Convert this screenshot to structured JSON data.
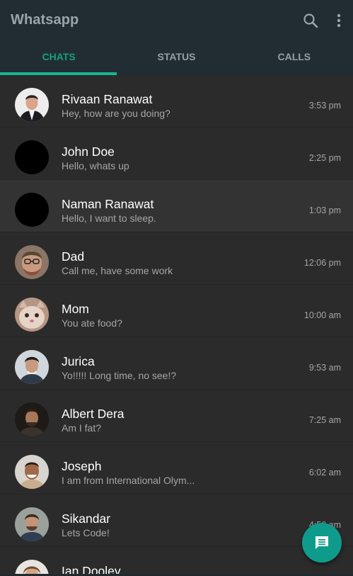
{
  "app": {
    "title": "Whatsapp"
  },
  "tabs": [
    {
      "label": "CHATS",
      "active": true
    },
    {
      "label": "STATUS",
      "active": false
    },
    {
      "label": "CALLS",
      "active": false
    }
  ],
  "chats": [
    {
      "name": "Rivaan Ranawat",
      "message": "Hey, how are you doing?",
      "time": "3:53 pm"
    },
    {
      "name": "John Doe",
      "message": "Hello, whats up",
      "time": "2:25 pm"
    },
    {
      "name": "Naman Ranawat",
      "message": "Hello, I want to sleep.",
      "time": "1:03 pm"
    },
    {
      "name": "Dad",
      "message": "Call me, have some work",
      "time": "12:06 pm"
    },
    {
      "name": "Mom",
      "message": "You ate food?",
      "time": "10:00 am"
    },
    {
      "name": "Jurica",
      "message": "Yo!!!!! Long time, no see!?",
      "time": "9:53 am"
    },
    {
      "name": "Albert Dera",
      "message": "Am I fat?",
      "time": "7:25 am"
    },
    {
      "name": "Joseph",
      "message": "I am from International Olym...",
      "time": "6:02 am"
    },
    {
      "name": "Sikandar",
      "message": "Lets Code!",
      "time": "4:56 am"
    },
    {
      "name": "Ian Dooley",
      "message": "",
      "time": ""
    }
  ],
  "colors": {
    "appbar": "#222d33",
    "accent": "#14b892",
    "fab": "#0f9b8b",
    "background": "#2b2b2b"
  },
  "icons": {
    "search": "search-icon",
    "more": "more-vert-icon",
    "fab": "message-icon"
  }
}
